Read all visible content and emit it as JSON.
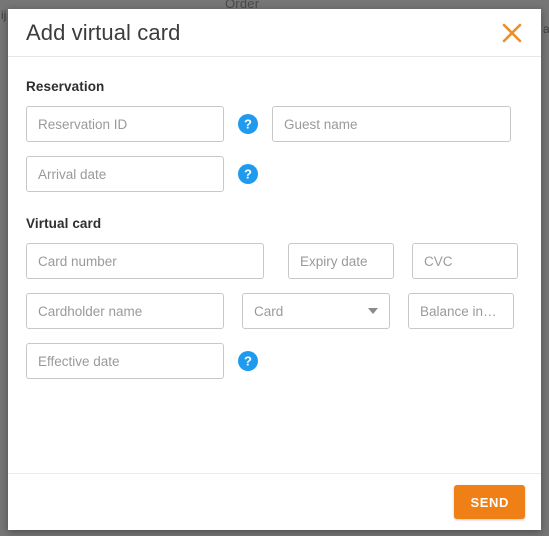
{
  "backdrop": {
    "partial_text_top": "Order",
    "partial_text_left": "ij",
    "partial_text_right": "a"
  },
  "dialog": {
    "title": "Add virtual card",
    "close_icon": "close-icon",
    "sections": [
      {
        "title": "Reservation",
        "rows": [
          {
            "fields": [
              {
                "name": "reservation-id-input",
                "placeholder": "Reservation ID",
                "value": "",
                "type": "text"
              },
              {
                "name": "reservation-id-help-icon",
                "type": "help",
                "glyph": "?"
              },
              {
                "name": "guest-name-input",
                "placeholder": "Guest name",
                "value": "",
                "type": "text"
              }
            ]
          },
          {
            "fields": [
              {
                "name": "arrival-date-input",
                "placeholder": "Arrival date",
                "value": "",
                "type": "text"
              },
              {
                "name": "arrival-date-help-icon",
                "type": "help",
                "glyph": "?"
              }
            ]
          }
        ]
      },
      {
        "title": "Virtual card",
        "rows": [
          {
            "fields": [
              {
                "name": "card-number-input",
                "placeholder": "Card number",
                "value": "",
                "type": "text"
              },
              {
                "name": "expiry-date-input",
                "placeholder": "Expiry date",
                "value": "",
                "type": "text"
              },
              {
                "name": "cvc-input",
                "placeholder": "CVC",
                "value": "",
                "type": "text"
              }
            ]
          },
          {
            "fields": [
              {
                "name": "cardholder-name-input",
                "placeholder": "Cardholder name",
                "value": "",
                "type": "text"
              },
              {
                "name": "card-type-select",
                "placeholder": "Card",
                "value": "",
                "type": "select"
              },
              {
                "name": "balance-input",
                "placeholder": "Balance in…",
                "value": "",
                "type": "text"
              }
            ]
          },
          {
            "fields": [
              {
                "name": "effective-date-input",
                "placeholder": "Effective date",
                "value": "",
                "type": "text"
              },
              {
                "name": "effective-date-help-icon",
                "type": "help",
                "glyph": "?"
              }
            ]
          }
        ]
      }
    ],
    "footer": {
      "send_label": "SEND"
    }
  },
  "colors": {
    "accent_orange": "#ee8016",
    "help_blue": "#1e9bef",
    "backdrop_gray": "#767676",
    "field_border": "#c8c8c8",
    "placeholder_text": "#9a9a9a"
  }
}
